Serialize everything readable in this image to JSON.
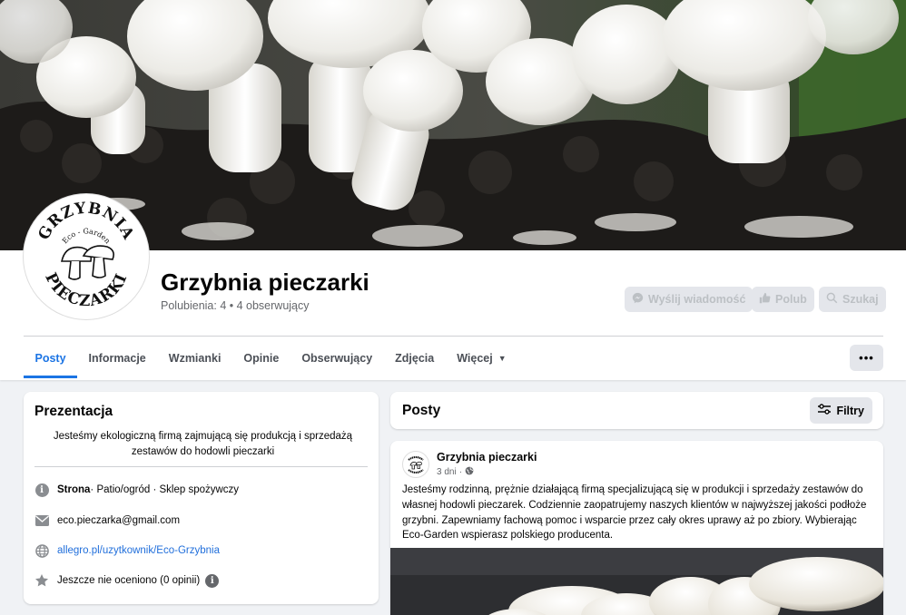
{
  "page": {
    "title": "Grzybnia pieczarki",
    "stats": "Polubienia: 4 • 4 obserwujący",
    "logo_text_top": "GRZYBNIA",
    "logo_text_mid": "Eco - Garden",
    "logo_text_bottom": "PIECZARKI"
  },
  "header_buttons": {
    "message": "Wyślij wiadomość",
    "like": "Polub",
    "search": "Szukaj"
  },
  "tabs": [
    {
      "label": "Posty",
      "active": true
    },
    {
      "label": "Informacje"
    },
    {
      "label": "Wzmianki"
    },
    {
      "label": "Opinie"
    },
    {
      "label": "Obserwujący"
    },
    {
      "label": "Zdjęcia"
    },
    {
      "label": "Więcej"
    }
  ],
  "more_button": "•••",
  "intro": {
    "title": "Prezentacja",
    "description": "Jesteśmy ekologiczną firmą zajmującą się produkcją i sprzedażą zestawów do hodowli pieczarki",
    "category_label": "Strona",
    "category_rest": " · Patio/ogród · Sklep spożywczy",
    "email": "eco.pieczarka@gmail.com",
    "website": "allegro.pl/uzytkownik/Eco-Grzybnia",
    "rating": "Jeszcze nie oceniono (0 opinii)"
  },
  "posts_header": {
    "title": "Posty",
    "filter_label": "Filtry"
  },
  "post": {
    "author": "Grzybnia pieczarki",
    "time": "3 dni",
    "text": "Jesteśmy rodzinną, prężnie działającą firmą specjalizującą się w produkcji i sprzedaży zestawów do własnej hodowli pieczarek. Codziennie zaopatrujemy naszych klientów w najwyższej jakości podłoże grzybni. Zapewniamy fachową pomoc i wsparcie przez cały okres uprawy aż po zbiory. Wybierając Eco-Garden wspierasz polskiego producenta."
  },
  "colors": {
    "accent": "#1b74e4",
    "link": "#216fdb",
    "background": "#f0f2f5"
  }
}
